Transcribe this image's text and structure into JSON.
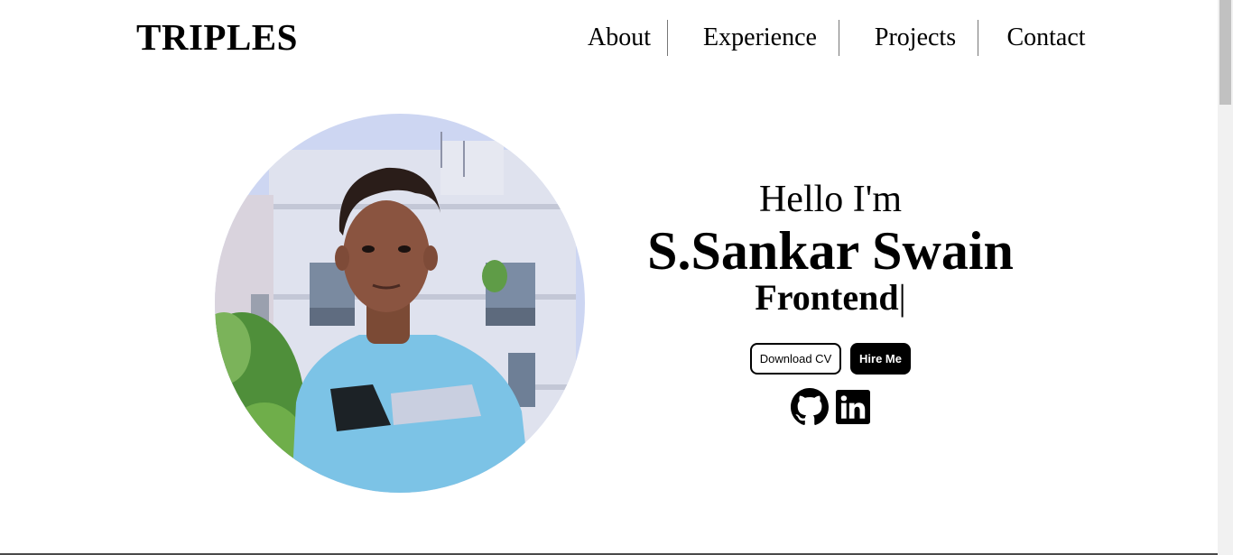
{
  "header": {
    "logo": "TRIPLES",
    "nav": [
      "About",
      "Experience",
      "Projects",
      "Contact"
    ]
  },
  "hero": {
    "greeting": "Hello I'm",
    "name": "S.Sankar Swain",
    "role": "Frontend",
    "caret": "|",
    "buttons": {
      "download_cv": "Download CV",
      "hire_me": "Hire Me"
    },
    "socials": [
      "github-icon",
      "linkedin-icon"
    ]
  },
  "colors": {
    "text": "#000000",
    "background": "#ffffff",
    "accent": "#000000"
  }
}
